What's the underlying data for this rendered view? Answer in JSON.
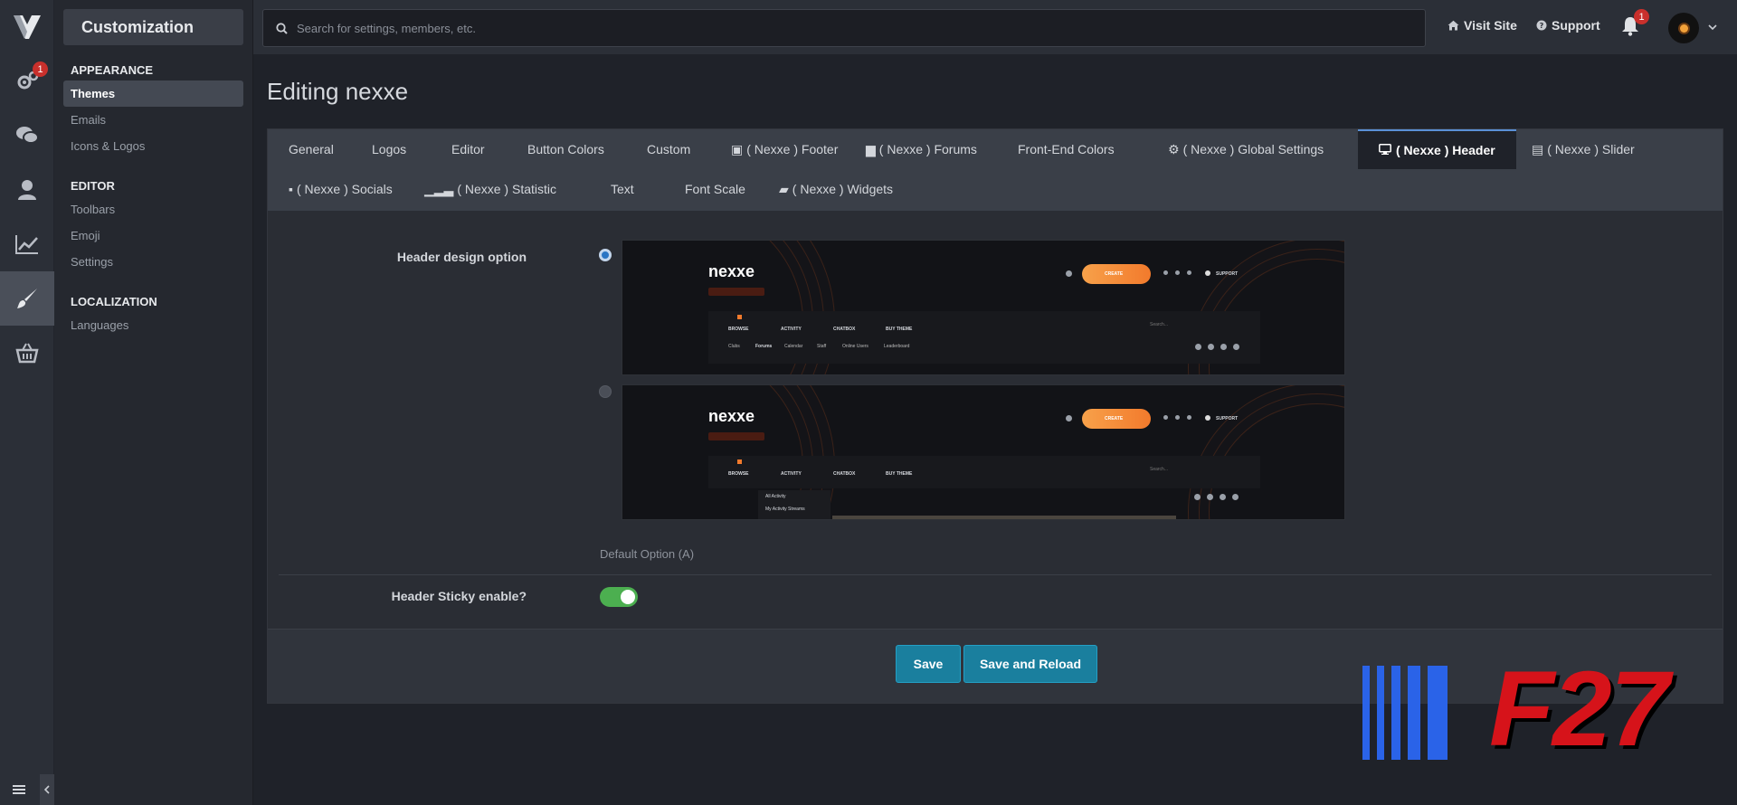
{
  "topbar": {
    "search_placeholder": "Search for settings, members, etc.",
    "visit_site": "Visit Site",
    "support": "Support",
    "notifications_count": "1"
  },
  "rail": {
    "settings_badge": "1"
  },
  "sidebar": {
    "title": "Customization",
    "sections": [
      {
        "label": "APPEARANCE",
        "items": [
          {
            "label": "Themes"
          },
          {
            "label": "Emails"
          },
          {
            "label": "Icons & Logos"
          }
        ]
      },
      {
        "label": "EDITOR",
        "items": [
          {
            "label": "Toolbars"
          },
          {
            "label": "Emoji"
          },
          {
            "label": "Settings"
          }
        ]
      },
      {
        "label": "LOCALIZATION",
        "items": [
          {
            "label": "Languages"
          }
        ]
      }
    ]
  },
  "page": {
    "title": "Editing nexxe"
  },
  "tabs": {
    "row1": [
      "General",
      "Logos",
      "Editor",
      "Button Colors",
      "Custom",
      "( Nexxe ) Footer",
      "( Nexxe ) Forums",
      "Front-End Colors",
      "( Nexxe ) Global Settings",
      "( Nexxe ) Header",
      "( Nexxe ) Slider"
    ],
    "row2": [
      "( Nexxe ) Socials",
      "( Nexxe ) Statistic",
      "Text",
      "Font Scale",
      "( Nexxe ) Widgets"
    ]
  },
  "form": {
    "header_design_label": "Header design option",
    "default_option_caption": "Default Option (A)",
    "sticky_label": "Header Sticky enable?",
    "sticky_enabled": true,
    "preview_brand": "nexxe",
    "preview_create": "CREATE",
    "preview_support": "SUPPORT",
    "preview_nav": [
      "BROWSE",
      "ACTIVITY",
      "CHATBOX",
      "BUY THEME"
    ],
    "preview_sub_nav": [
      "Clubs",
      "Forums",
      "Calendar",
      "Staff",
      "Online Users",
      "Leaderboard"
    ],
    "preview_search": "Search...",
    "preview_menu": [
      "All Activity",
      "My Activity Streams"
    ]
  },
  "buttons": {
    "save": "Save",
    "save_reload": "Save and Reload"
  },
  "watermark": {
    "text": "F27"
  },
  "colors": {
    "accent_button": "#1a7f9e",
    "toggle_on": "#4caf50",
    "badge": "#c9302c"
  }
}
